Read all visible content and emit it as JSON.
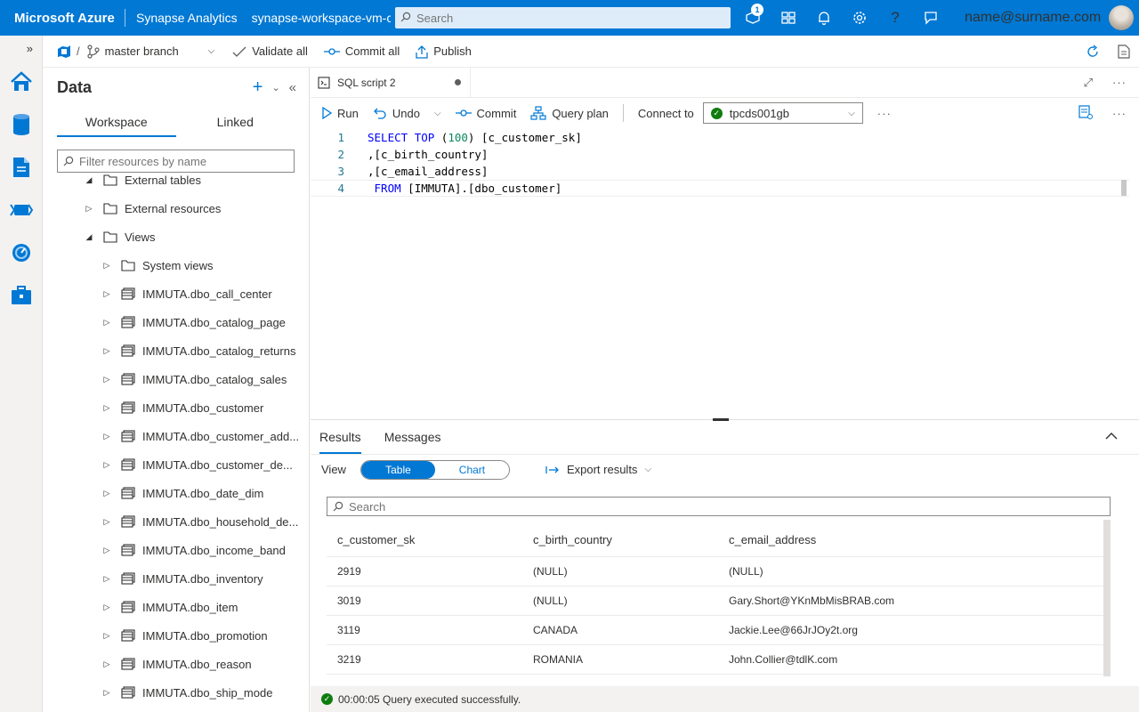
{
  "header": {
    "brand": "Microsoft Azure",
    "service": "Synapse Analytics",
    "workspace": "synapse-workspace-vm-c",
    "search_placeholder": "Search",
    "notification_count": "1",
    "user_email": "name@surname.com"
  },
  "toolbar": {
    "branch": "master branch",
    "validate_all": "Validate all",
    "commit_all": "Commit all",
    "publish": "Publish"
  },
  "data_panel": {
    "title": "Data",
    "tabs": [
      "Workspace",
      "Linked"
    ],
    "filter_placeholder": "Filter resources by name",
    "tree": [
      {
        "label": "External tables",
        "type": "folder",
        "expanded": true,
        "level": 1
      },
      {
        "label": "External resources",
        "type": "folder",
        "expanded": false,
        "level": 1
      },
      {
        "label": "Views",
        "type": "folder",
        "expanded": true,
        "level": 1
      },
      {
        "label": "System views",
        "type": "folder",
        "expanded": false,
        "level": 2
      },
      {
        "label": "IMMUTA.dbo_call_center",
        "type": "view",
        "expanded": false,
        "level": 2
      },
      {
        "label": "IMMUTA.dbo_catalog_page",
        "type": "view",
        "expanded": false,
        "level": 2
      },
      {
        "label": "IMMUTA.dbo_catalog_returns",
        "type": "view",
        "expanded": false,
        "level": 2
      },
      {
        "label": "IMMUTA.dbo_catalog_sales",
        "type": "view",
        "expanded": false,
        "level": 2
      },
      {
        "label": "IMMUTA.dbo_customer",
        "type": "view",
        "expanded": false,
        "level": 2
      },
      {
        "label": "IMMUTA.dbo_customer_add...",
        "type": "view",
        "expanded": false,
        "level": 2
      },
      {
        "label": "IMMUTA.dbo_customer_de...",
        "type": "view",
        "expanded": false,
        "level": 2
      },
      {
        "label": "IMMUTA.dbo_date_dim",
        "type": "view",
        "expanded": false,
        "level": 2
      },
      {
        "label": "IMMUTA.dbo_household_de...",
        "type": "view",
        "expanded": false,
        "level": 2
      },
      {
        "label": "IMMUTA.dbo_income_band",
        "type": "view",
        "expanded": false,
        "level": 2
      },
      {
        "label": "IMMUTA.dbo_inventory",
        "type": "view",
        "expanded": false,
        "level": 2
      },
      {
        "label": "IMMUTA.dbo_item",
        "type": "view",
        "expanded": false,
        "level": 2
      },
      {
        "label": "IMMUTA.dbo_promotion",
        "type": "view",
        "expanded": false,
        "level": 2
      },
      {
        "label": "IMMUTA.dbo_reason",
        "type": "view",
        "expanded": false,
        "level": 2
      },
      {
        "label": "IMMUTA.dbo_ship_mode",
        "type": "view",
        "expanded": false,
        "level": 2
      }
    ]
  },
  "editor": {
    "tab_label": "SQL script 2",
    "run": "Run",
    "undo": "Undo",
    "commit": "Commit",
    "query_plan": "Query plan",
    "connect_to": "Connect to",
    "connection": "tpcds001gb",
    "lines": [
      {
        "num": "1",
        "tokens": [
          {
            "t": "SELECT",
            "k": "kw"
          },
          {
            "t": " ",
            "k": ""
          },
          {
            "t": "TOP",
            "k": "kw"
          },
          {
            "t": " (",
            "k": ""
          },
          {
            "t": "100",
            "k": "num"
          },
          {
            "t": ") [c_customer_sk]",
            "k": ""
          }
        ]
      },
      {
        "num": "2",
        "tokens": [
          {
            "t": ",[c_birth_country]",
            "k": ""
          }
        ]
      },
      {
        "num": "3",
        "tokens": [
          {
            "t": ",[c_email_address]",
            "k": ""
          }
        ]
      },
      {
        "num": "4",
        "tokens": [
          {
            "t": " FROM",
            "k": "kw"
          },
          {
            "t": " [IMMUTA].[dbo_customer]",
            "k": ""
          }
        ]
      }
    ]
  },
  "results": {
    "tabs": [
      "Results",
      "Messages"
    ],
    "view_label": "View",
    "view_options": [
      "Table",
      "Chart"
    ],
    "export": "Export results",
    "search_placeholder": "Search",
    "columns": [
      "c_customer_sk",
      "c_birth_country",
      "c_email_address"
    ],
    "rows": [
      [
        "2919",
        "(NULL)",
        "(NULL)"
      ],
      [
        "3019",
        "(NULL)",
        "Gary.Short@YKnMbMisBRAB.com"
      ],
      [
        "3119",
        "CANADA",
        "Jackie.Lee@66JrJOy2t.org"
      ],
      [
        "3219",
        "ROMANIA",
        "John.Collier@tdlK.com"
      ]
    ]
  },
  "status": {
    "message": "00:00:05 Query executed successfully."
  },
  "colors": {
    "accent": "#0078d4",
    "success": "#107c10"
  }
}
